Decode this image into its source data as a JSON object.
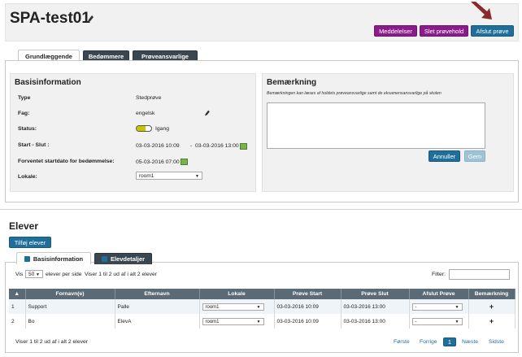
{
  "header": {
    "title": "SPA-test01",
    "buttons": {
      "meddelelser": "Meddelelser",
      "slet": "Slet prøvehold",
      "afslut": "Afslut prøve"
    }
  },
  "tabs": [
    "Grundlæggende",
    "Bedømmere",
    "Prøveansvarlige"
  ],
  "basis": {
    "title": "Basisinformation",
    "type_label": "Type",
    "type_value": "Stedprøve",
    "fag_label": "Fag:",
    "fag_value": "engelsk",
    "status_label": "Status:",
    "status_value": "Igang",
    "startslut_label": "Start - Slut :",
    "start_value": "03-03-2016 10:09",
    "dash": "-",
    "slut_value": "03-03-2016 13:00",
    "forventet_label": "Forventet startdato for bedømmelse:",
    "forventet_value": "05-03-2016 07:00",
    "lokale_label": "Lokale:",
    "lokale_value": "room1"
  },
  "remark": {
    "title": "Bemærkning",
    "subtitle": "Bemærkningen kan læses af holdets prøveansvarlige samt de eksamensansvarlige på skolen",
    "annuller": "Annuller",
    "gem": "Gem"
  },
  "elever": {
    "title": "Elever",
    "add_button": "Tilføj elever",
    "tabs": [
      "Basisinformation",
      "Elevdetaljer"
    ],
    "vis": "Vis",
    "per_page": "50",
    "per_page_suffix": "elever per side",
    "showing": "Viser 1 til 2 ud af i alt 2 elever",
    "filter_label": "Filter:",
    "columns": [
      "Fornavn(e)",
      "Efternavn",
      "Lokale",
      "Prøve Start",
      "Prøve Slut",
      "Afslut Prøve",
      "Bemærkning"
    ],
    "rows": [
      {
        "num": "1",
        "fornavn": "Support",
        "efternavn": "Palle",
        "lokale": "room1",
        "start": "03-03-2016 10:09",
        "slut": "03-03-2016 13:00",
        "afslut": "-"
      },
      {
        "num": "2",
        "fornavn": "Bo",
        "efternavn": "ElevA",
        "lokale": "room1",
        "start": "03-03-2016 10:09",
        "slut": "03-03-2016 13:00",
        "afslut": "-"
      }
    ],
    "footer": "Viser 1 til 2 ud af i alt 2 elever",
    "pager": {
      "first": "Første",
      "prev": "Forrige",
      "page": "1",
      "next": "Næste",
      "last": "Sidste"
    }
  },
  "colors": {
    "purple": "#8a1b8a",
    "blue": "#1f6f9a",
    "dark_tab": "#3a4650",
    "table_header": "#5a6a76",
    "toggle": "#c8c400",
    "calendar": "#7bb24a"
  }
}
